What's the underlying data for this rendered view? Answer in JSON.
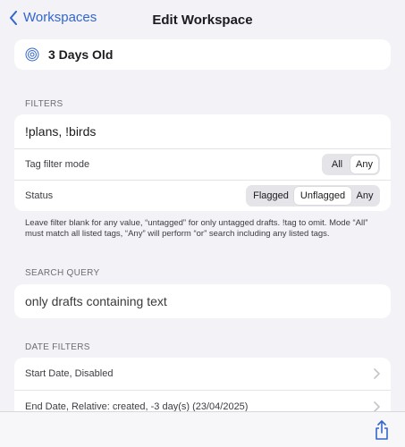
{
  "nav": {
    "back_label": "Workspaces",
    "title": "Edit Workspace"
  },
  "workspace": {
    "name": "3 Days Old",
    "icon": "concentric-circle-icon"
  },
  "filters": {
    "header": "FILTERS",
    "tags_value": "!plans, !birds",
    "tag_filter_mode_label": "Tag filter mode",
    "tag_filter_mode_options": [
      "All",
      "Any"
    ],
    "tag_filter_mode_selected": "Any",
    "status_label": "Status",
    "status_options": [
      "Flagged",
      "Unflagged",
      "Any"
    ],
    "status_selected": "Unflagged",
    "help_text": "Leave filter blank for any value, “untagged” for only untagged drafts. !tag to omit. Mode “All” must match all listed tags, “Any” will perform “or” search including any listed tags."
  },
  "search_query": {
    "header": "SEARCH QUERY",
    "value": "only drafts containing text"
  },
  "date_filters": {
    "header": "DATE FILTERS",
    "start_date": "Start Date, Disabled",
    "end_date": "End Date, Relative: created, -3 day(s) (23/04/2025)"
  },
  "colors": {
    "accent": "#3366cc",
    "background": "#f2f2f7",
    "card": "#ffffff"
  }
}
